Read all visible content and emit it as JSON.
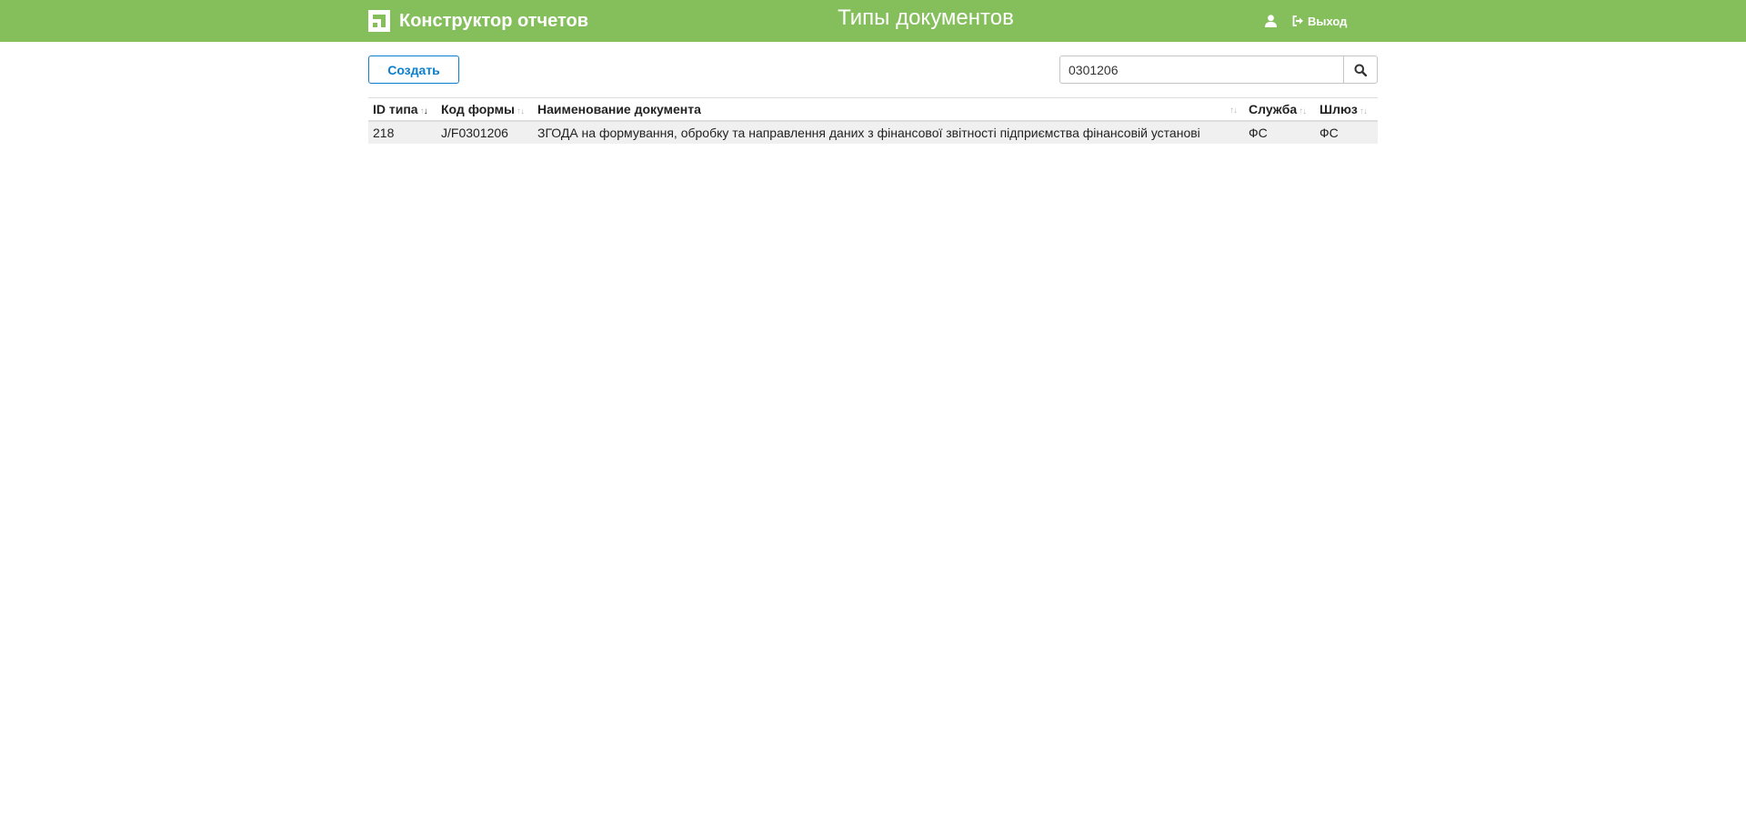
{
  "header": {
    "app_title": "Конструктор отчетов",
    "page_title": "Типы документов",
    "logout_label": "Выход"
  },
  "toolbar": {
    "create_label": "Создать",
    "search_value": "0301206"
  },
  "table": {
    "columns": [
      "ID типа",
      "Код формы",
      "Наименование документа",
      "Служба",
      "Шлюз"
    ],
    "sort": {
      "column": "ID типа",
      "direction": "desc"
    },
    "rows": [
      [
        "218",
        "J/F0301206",
        "ЗГОДА на формування, обробку та направлення даних з фінансової звітності підприємства фінансовій установі",
        "ФС",
        "ФС"
      ]
    ]
  },
  "colors": {
    "header_bg": "#85bf5c",
    "accent": "#0b7fd0",
    "row_bg": "#f0f0f0"
  },
  "icons": [
    "brand-logo-icon",
    "user-icon",
    "sign-out-icon",
    "search-icon",
    "sort-icon"
  ]
}
